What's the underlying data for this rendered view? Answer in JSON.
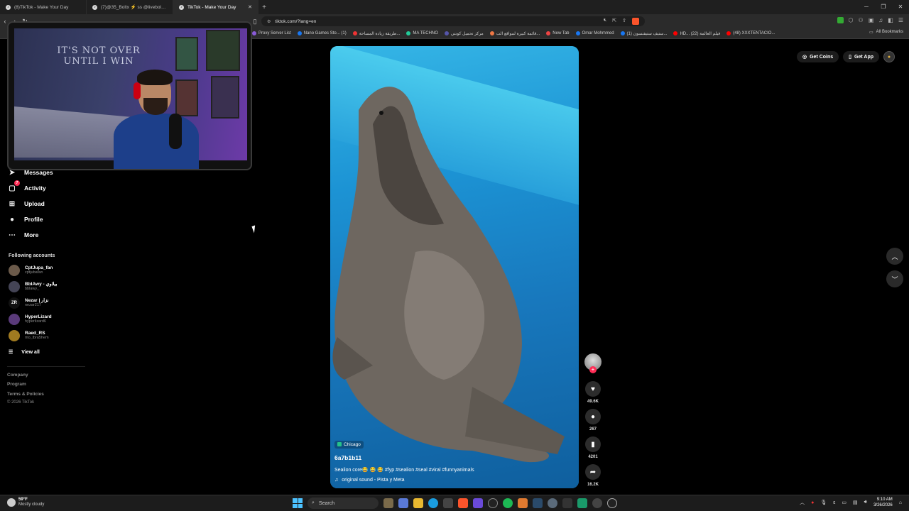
{
  "browser": {
    "tabs": [
      {
        "title": "(8)TikTok - Make Your Day",
        "active": false
      },
      {
        "title": "(7)@35_Boltx ⚡ ss @liveboltx @3aW",
        "active": false
      },
      {
        "title": "TikTok - Make Your Day",
        "active": true
      }
    ],
    "url": "tiktok.com/?lang=en",
    "bookmarks": [
      "Proxy Server List",
      "Nano Games Sto... (1)",
      "طريقة زيادة المساحة...",
      "MA TECHNO",
      "مركز تحميل كونتي",
      "قائمة كبيرة لمواقع الت...",
      "New Tab",
      "Omar Mohmmed",
      "(1) ستيف ستيفنسون...",
      "HD... فيلم العالمة (22)",
      "(48) XXXTENTACIO..."
    ],
    "all_bookmarks": "All Bookmarks"
  },
  "sidebar": {
    "nav": [
      {
        "label": "Messages",
        "icon": "messages-icon"
      },
      {
        "label": "Activity",
        "icon": "activity-icon",
        "badge": "7"
      },
      {
        "label": "Upload",
        "icon": "upload-icon"
      },
      {
        "label": "Profile",
        "icon": "profile-icon"
      },
      {
        "label": "More",
        "icon": "more-icon"
      }
    ],
    "following_title": "Following accounts",
    "accounts": [
      {
        "name": "CptJupa_fan",
        "handle": "cptjubafan"
      },
      {
        "name": "BblAwy - بيلاوي",
        "handle": "bblawy_"
      },
      {
        "name": "Nezar | نزار",
        "handle": "nezar217"
      },
      {
        "name": "HyperLizard",
        "handle": "hyperlizard6"
      },
      {
        "name": "Raed_RS",
        "handle": "mo_lbra5hem"
      }
    ],
    "view_all": "View all",
    "footer": [
      "Company",
      "Program",
      "Terms & Policies",
      "© 2026 TikTok"
    ]
  },
  "webcam": {
    "poster_line1": "IT'S NOT OVER",
    "poster_line2": "UNTIL I WIN"
  },
  "video": {
    "location": "Chicago",
    "author": "6a7b1b11",
    "caption": "Sealion core😂 😂 😂 #fyp #sealion #seal #viral #funnyanimals",
    "sound": "original sound - Pista y Meta"
  },
  "actions": {
    "likes": "49.6K",
    "comments": "267",
    "saves": "4201",
    "shares": "16.2K"
  },
  "topright": {
    "get_coins": "Get Coins",
    "get_app": "Get App"
  },
  "taskbar": {
    "temp": "59°F",
    "weather": "Mostly cloudy",
    "search": "Search",
    "time": "9:10 AM",
    "date": "3/26/2026"
  },
  "colors": {
    "accent": "#fe2c55",
    "background": "#000000",
    "video_water": "#1c93d4"
  }
}
